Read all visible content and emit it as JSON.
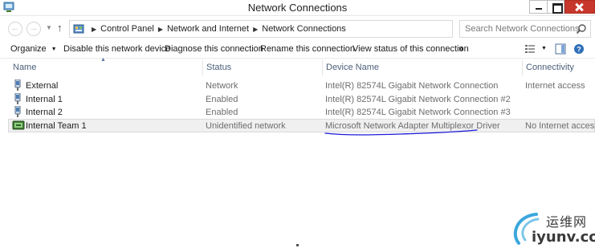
{
  "window": {
    "title": "Network Connections"
  },
  "address": {
    "breadcrumbs": [
      "Control Panel",
      "Network and Internet",
      "Network Connections"
    ],
    "search_placeholder": "Search Network Connections"
  },
  "commands": {
    "organize": "Organize",
    "disable": "Disable this network device",
    "diagnose": "Diagnose this connection",
    "rename": "Rename this connection",
    "view_status": "View status of this connection",
    "more": "»"
  },
  "columns": {
    "name": "Name",
    "status": "Status",
    "device": "Device Name",
    "connectivity": "Connectivity"
  },
  "rows": [
    {
      "name": "External",
      "status": "Network",
      "device": "Intel(R) 82574L Gigabit Network Connection",
      "connectivity": "Internet access",
      "icon": "network-adapter-icon"
    },
    {
      "name": "Internal 1",
      "status": "Enabled",
      "device": "Intel(R) 82574L Gigabit Network Connection #2",
      "connectivity": "",
      "icon": "network-adapter-icon"
    },
    {
      "name": "Internal 2",
      "status": "Enabled",
      "device": "Intel(R) 82574L Gigabit Network Connection #3",
      "connectivity": "",
      "icon": "network-adapter-icon"
    },
    {
      "name": "Internal Team 1",
      "status": "Unidentified network",
      "device": "Microsoft Network Adapter Multiplexor Driver",
      "connectivity": "No Internet access",
      "icon": "team-adapter-icon"
    }
  ],
  "watermark": {
    "cn": "运维网",
    "url": "iyunv.com"
  },
  "colors": {
    "annotation": "#1a1adb",
    "header_text": "#4c607a",
    "close_red": "#c7372b"
  }
}
